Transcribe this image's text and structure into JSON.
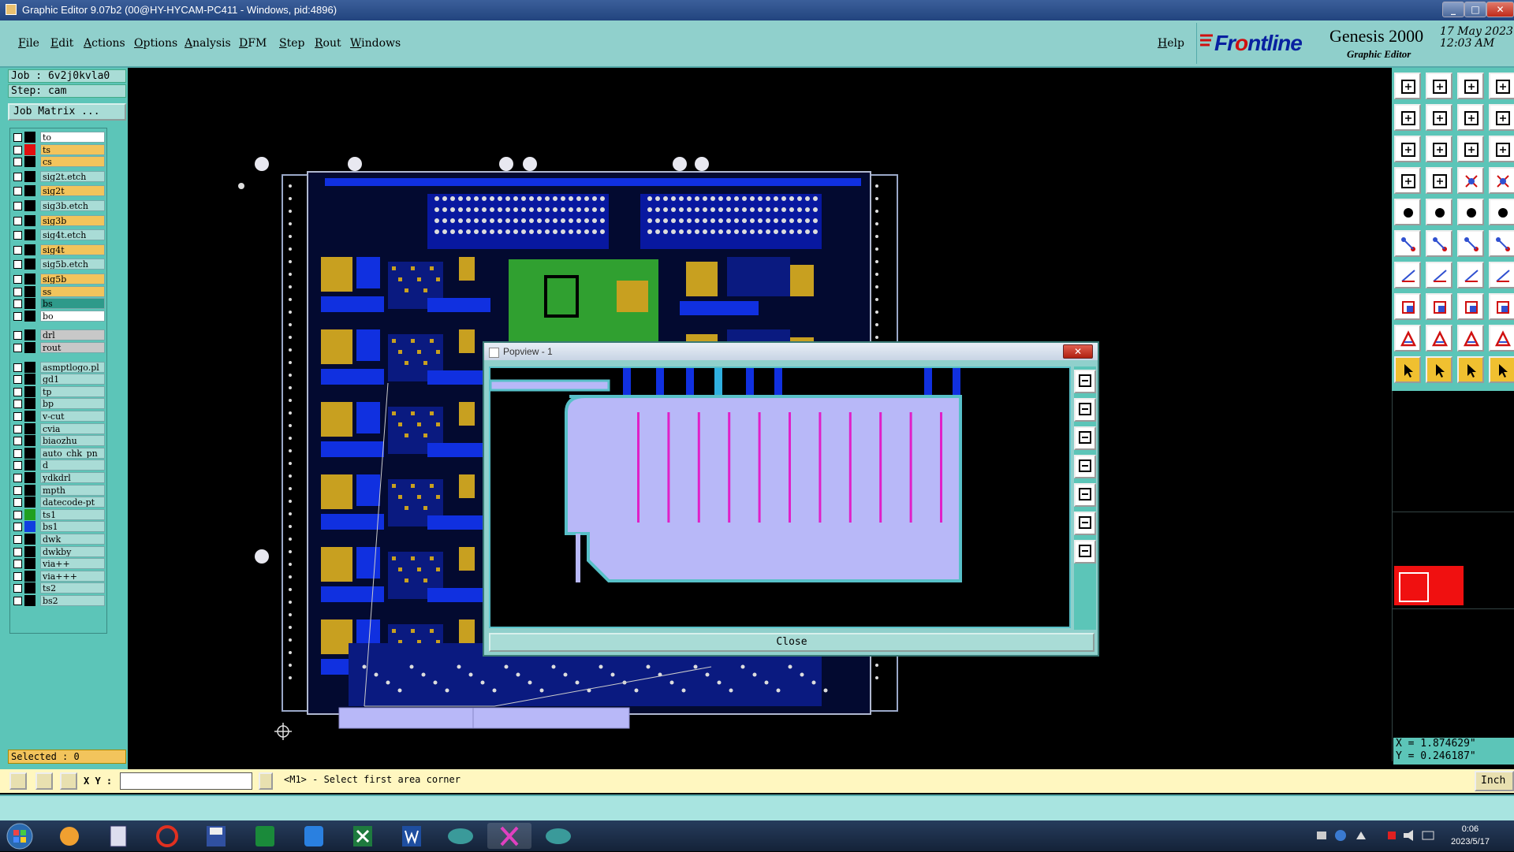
{
  "window": {
    "title": "Graphic Editor 9.07b2 (00@HY-HYCAM-PC411 - Windows, pid:4896)",
    "min": "_",
    "max": "□",
    "close": "✕"
  },
  "menu": [
    "File",
    "Edit",
    "Actions",
    "Options",
    "Analysis",
    "DFM",
    "Step",
    "Rout",
    "Windows"
  ],
  "help": "Help",
  "brand": {
    "frontline_a": "Fr",
    "frontline_o": "o",
    "frontline_b": "ntline",
    "product": "Genesis 2000",
    "subtitle": "Graphic Editor",
    "date": "17 May 2023",
    "time": "12:03 AM"
  },
  "job": {
    "job_label": "Job : 6v2j0kvla0",
    "step_label": "Step: cam",
    "matrix_button": "Job Matrix ..."
  },
  "layers": [
    {
      "name": "to",
      "color": "#ffffff",
      "swatch": "#000000",
      "gap": false
    },
    {
      "name": "ts",
      "color": "#f2c45c",
      "swatch": "#e01010",
      "gap": false
    },
    {
      "name": "cs",
      "color": "#f2c45c",
      "swatch": "#000000",
      "gap": false
    },
    {
      "name": "sig2t.etch",
      "color": "#a9dcd6",
      "swatch": "#000000",
      "gap": true
    },
    {
      "name": "sig2t",
      "color": "#f2c45c",
      "swatch": "#000000",
      "gap": true
    },
    {
      "name": "sig3b.etch",
      "color": "#a9dcd6",
      "swatch": "#000000",
      "gap": true
    },
    {
      "name": "sig3b",
      "color": "#f2c45c",
      "swatch": "#000000",
      "gap": true
    },
    {
      "name": "sig4t.etch",
      "color": "#a9dcd6",
      "swatch": "#000000",
      "gap": true
    },
    {
      "name": "sig4t",
      "color": "#f2c45c",
      "swatch": "#000000",
      "gap": true
    },
    {
      "name": "sig5b.etch",
      "color": "#a9dcd6",
      "swatch": "#000000",
      "gap": true
    },
    {
      "name": "sig5b",
      "color": "#f2c45c",
      "swatch": "#000000",
      "gap": true
    },
    {
      "name": "ss",
      "color": "#f2c45c",
      "swatch": "#000000",
      "gap": false
    },
    {
      "name": "bs",
      "color": "#2e9a8a",
      "swatch": "#000000",
      "gap": false
    },
    {
      "name": "bo",
      "color": "#ffffff",
      "swatch": "#000000",
      "gap": false
    },
    {
      "name": "drl",
      "color": "#c8c8c8",
      "swatch": "#000000",
      "gap": true
    },
    {
      "name": "rout",
      "color": "#c8c8c8",
      "swatch": "#000000",
      "gap": false
    },
    {
      "name": "asmptlogo.pl",
      "color": "#a9dcd6",
      "swatch": "#000000",
      "gap": true
    },
    {
      "name": "gd1",
      "color": "#a9dcd6",
      "swatch": "#000000",
      "gap": false
    },
    {
      "name": "tp",
      "color": "#a9dcd6",
      "swatch": "#000000",
      "gap": false
    },
    {
      "name": "bp",
      "color": "#a9dcd6",
      "swatch": "#000000",
      "gap": false
    },
    {
      "name": "v-cut",
      "color": "#a9dcd6",
      "swatch": "#000000",
      "gap": false
    },
    {
      "name": "cvia",
      "color": "#a9dcd6",
      "swatch": "#000000",
      "gap": false
    },
    {
      "name": "biaozhu",
      "color": "#a9dcd6",
      "swatch": "#000000",
      "gap": false
    },
    {
      "name": "auto_chk_pn",
      "color": "#a9dcd6",
      "swatch": "#000000",
      "gap": false
    },
    {
      "name": "d",
      "color": "#a9dcd6",
      "swatch": "#000000",
      "gap": false
    },
    {
      "name": "ydkdrl",
      "color": "#a9dcd6",
      "swatch": "#000000",
      "gap": false
    },
    {
      "name": "mpth",
      "color": "#a9dcd6",
      "swatch": "#000000",
      "gap": false
    },
    {
      "name": "datecode-pt",
      "color": "#a9dcd6",
      "swatch": "#000000",
      "gap": false
    },
    {
      "name": "ts1",
      "color": "#a9dcd6",
      "swatch": "#20a020",
      "gap": false
    },
    {
      "name": "bs1",
      "color": "#a9dcd6",
      "swatch": "#1040e0",
      "gap": false
    },
    {
      "name": "dwk",
      "color": "#a9dcd6",
      "swatch": "#000000",
      "gap": false
    },
    {
      "name": "dwkby",
      "color": "#a9dcd6",
      "swatch": "#000000",
      "gap": false
    },
    {
      "name": "via++",
      "color": "#a9dcd6",
      "swatch": "#000000",
      "gap": false
    },
    {
      "name": "via+++",
      "color": "#a9dcd6",
      "swatch": "#000000",
      "gap": false
    },
    {
      "name": "ts2",
      "color": "#a9dcd6",
      "swatch": "#000000",
      "gap": false
    },
    {
      "name": "bs2",
      "color": "#a9dcd6",
      "swatch": "#000000",
      "gap": false
    }
  ],
  "selected": "Selected : 0",
  "coords": {
    "x": "X = 1.874629\"",
    "y": "Y = 0.246187\""
  },
  "cmd": {
    "xy_label": "X Y :",
    "xy_value": "",
    "prompt": "<M1> - Select first area corner",
    "unit": "Inch ="
  },
  "popview": {
    "title": "Popview - 1",
    "close_x": "✕",
    "close_button": "Close"
  },
  "taskbar": {
    "time": "0:06",
    "date": "2023/5/17"
  },
  "colors": {
    "panel": "#5cc5b8",
    "menubar": "#90d0cc",
    "copper_blue": "#1030e0",
    "copper_gold": "#c8a020",
    "pad_lavender": "#b8b8f8",
    "slot_magenta": "#e020c8"
  }
}
